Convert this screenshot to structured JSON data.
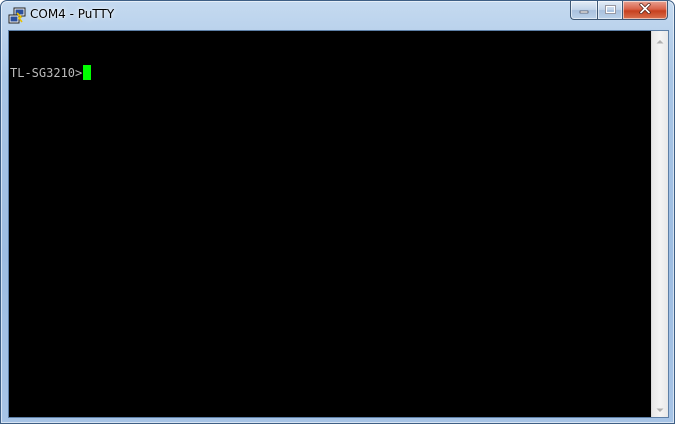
{
  "window": {
    "title": "COM4 - PuTTY",
    "icons": {
      "app": "putty-icon",
      "minimize": "minimize-icon",
      "maximize": "maximize-icon",
      "close": "close-icon",
      "scroll_up": "scroll-up-arrow-icon",
      "scroll_down": "scroll-down-arrow-icon"
    }
  },
  "terminal": {
    "prompt": "TL-SG3210>",
    "colors": {
      "background": "#000000",
      "text": "#bbbbbb",
      "cursor": "#00ff00"
    }
  }
}
